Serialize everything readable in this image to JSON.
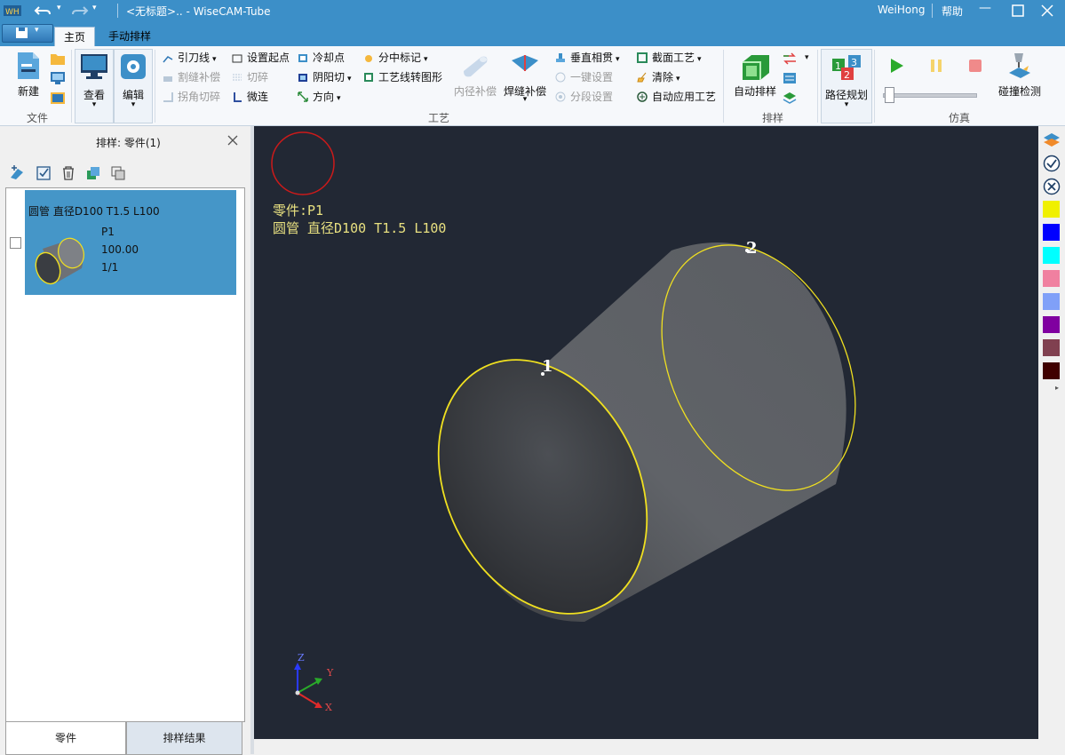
{
  "window": {
    "title": "<无标题>.. - WiseCAM-Tube",
    "user": "WeiHong",
    "help": "帮助"
  },
  "tabs": [
    "主页",
    "手动排样"
  ],
  "ribbon": {
    "file_group": {
      "new": "新建",
      "label": "文件"
    },
    "view": "查看",
    "edit": "编辑",
    "craft_group": {
      "label": "工艺",
      "col1": [
        "引刀线",
        "割缝补偿",
        "拐角切碎"
      ],
      "col2": [
        "设置起点",
        "切碎",
        "微连"
      ],
      "col3": [
        "冷却点",
        "阴阳切",
        "方向"
      ],
      "col4": [
        "分中标记",
        "工艺线转图形"
      ],
      "inner_comp": "内径补偿",
      "weld_comp": "焊缝补偿",
      "col5": [
        "垂直相贯",
        "一键设置",
        "分段设置"
      ],
      "col6": [
        "截面工艺",
        "清除",
        "自动应用工艺"
      ]
    },
    "nest_group": {
      "label": "排样",
      "auto_nest": "自动排样"
    },
    "path_plan": "路径规划",
    "sim_group": {
      "label": "仿真",
      "collision": "碰撞检测"
    }
  },
  "left_panel": {
    "title": "排样: 零件(1)",
    "part": {
      "desc": "圆管 直径D100 T1.5 L100",
      "name": "P1",
      "length": "100.00",
      "count": "1/1"
    },
    "bottom_tabs": [
      "零件",
      "排样结果"
    ]
  },
  "viewport": {
    "part_label": "零件:P1",
    "part_desc": "圆管 直径D100 T1.5 L100",
    "marker1": "1",
    "marker2": "2",
    "axes": {
      "z": "Z",
      "y": "Y",
      "x": "X"
    }
  },
  "colors": {
    "accent": "#3c8fc8",
    "viewport_bg": "#222834",
    "contour": "#f0e020",
    "swatches": [
      "#f0f000",
      "#0000ff",
      "#00ffff",
      "#f080a0",
      "#80a0f8",
      "#8000a0",
      "#804050",
      "#400000"
    ]
  },
  "icons": {
    "layers": "layers-icon",
    "check": "check-circle-icon",
    "cancel": "cancel-circle-icon"
  }
}
